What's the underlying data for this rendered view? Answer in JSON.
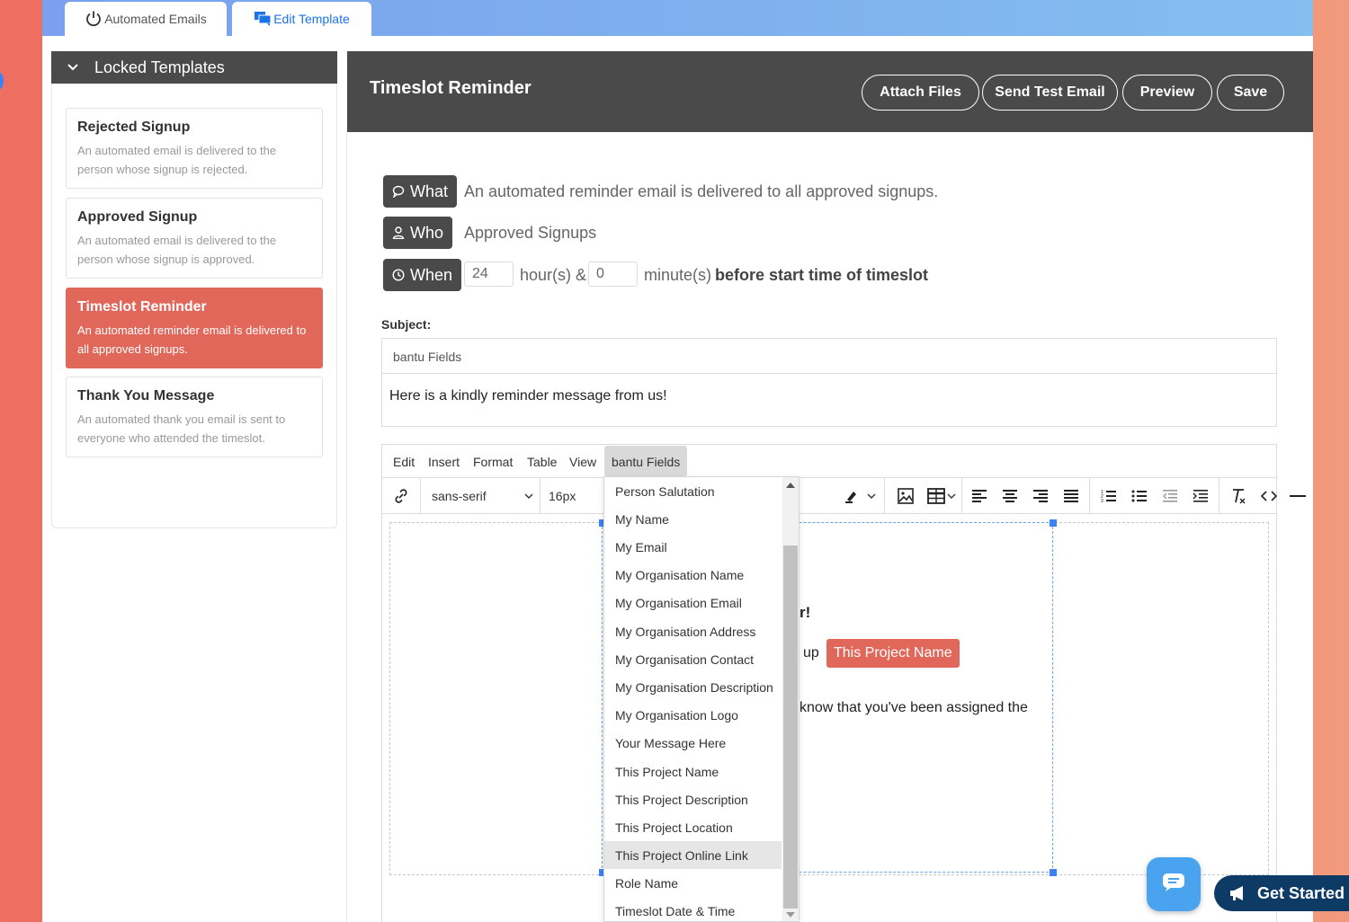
{
  "tabs": {
    "automated": "Automated Emails",
    "edit": "Edit Template"
  },
  "sidebar": {
    "header": "Locked Templates",
    "templates": [
      {
        "title": "Rejected Signup",
        "desc": "An automated email is delivered to the person whose signup is rejected."
      },
      {
        "title": "Approved Signup",
        "desc": "An automated email is delivered to the person whose signup is approved."
      },
      {
        "title": "Timeslot Reminder",
        "desc": "An automated reminder email is delivered to all approved signups."
      },
      {
        "title": "Thank You Message",
        "desc": "An automated thank you email is sent to everyone who attended the timeslot."
      }
    ]
  },
  "main": {
    "title": "Timeslot Reminder",
    "buttons": {
      "attach": "Attach Files",
      "test": "Send Test Email",
      "preview": "Preview",
      "save": "Save"
    },
    "what_label": "What",
    "what_text": "An automated reminder email is delivered to all approved signups.",
    "who_label": "Who",
    "who_text": "Approved Signups",
    "when_label": "When",
    "hours_value": "24",
    "hours_text": "hour(s) &",
    "minutes_value": "0",
    "minutes_text": "minute(s)",
    "when_suffix": "before start time of timeslot"
  },
  "subject": {
    "label": "Subject:",
    "fields_menu": "bantu Fields",
    "text": "Here is a kindly reminder message from us!"
  },
  "editor": {
    "menu": [
      "Edit",
      "Insert",
      "Format",
      "Table",
      "View",
      "bantu Fields"
    ],
    "font": "sans-serif",
    "size": "16px",
    "body": {
      "frag1": "r!",
      "frag2": "up",
      "chip": "This Project Name",
      "frag3": "know that you've been assigned the"
    }
  },
  "dropdown": {
    "items": [
      "Person Salutation",
      "My Name",
      "My Email",
      "My Organisation Name",
      "My Organisation Email",
      "My Organisation Address",
      "My Organisation Contact",
      "My Organisation Description",
      "My Organisation Logo",
      "Your Message Here",
      "This Project Name",
      "This Project Description",
      "This Project Location",
      "This Project Online Link",
      "Role Name",
      "Timeslot Date & Time"
    ],
    "highlighted": "This Project Online Link"
  },
  "cta": {
    "get_started": "Get Started"
  },
  "colors": {
    "accent": "#e0675a",
    "dark_header": "#4a4a4a",
    "link_blue": "#1a73e8",
    "cta_navy": "#0d3b66"
  }
}
